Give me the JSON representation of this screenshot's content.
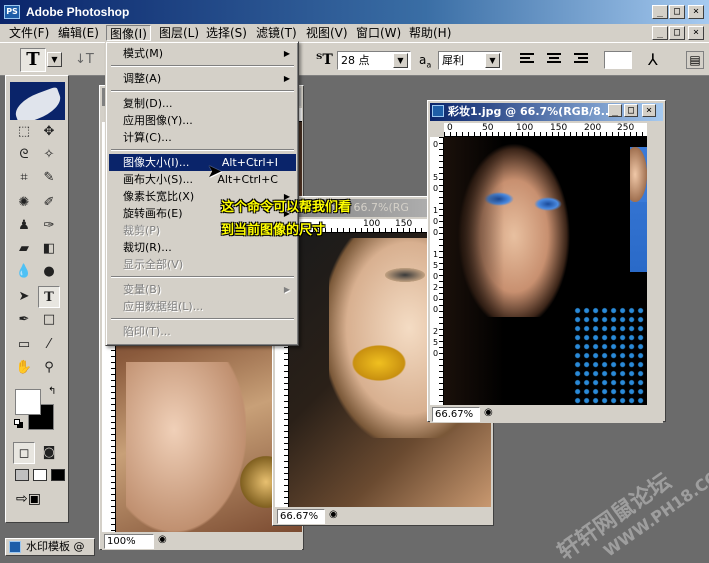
{
  "app": {
    "title": "Adobe Photoshop",
    "logo": "PS"
  },
  "caption_buttons": {
    "minimize": "_",
    "maximize": "□",
    "close": "×"
  },
  "menubar": [
    "文件(F)",
    "编辑(E)",
    "图像(I)",
    "图层(L)",
    "选择(S)",
    "滤镜(T)",
    "视图(V)",
    "窗口(W)",
    "帮助(H)"
  ],
  "options": {
    "tool_glyph": "T",
    "font_size": "28 点",
    "aa_label": "a",
    "aa_sub": "a",
    "aa_mode": "犀利"
  },
  "image_menu": {
    "items": [
      {
        "label": "模式(M)",
        "submenu": true
      },
      {
        "sep": true
      },
      {
        "label": "调整(A)",
        "submenu": true
      },
      {
        "sep": true
      },
      {
        "label": "复制(D)..."
      },
      {
        "label": "应用图像(Y)..."
      },
      {
        "label": "计算(C)..."
      },
      {
        "sep": true
      },
      {
        "label": "图像大小(I)...",
        "shortcut": "Alt+Ctrl+I",
        "highlighted": true
      },
      {
        "label": "画布大小(S)...",
        "shortcut": "Alt+Ctrl+C"
      },
      {
        "label": "像素长宽比(X)",
        "submenu": true
      },
      {
        "label": "旋转画布(E)",
        "submenu": true
      },
      {
        "label": "裁剪(P)",
        "disabled": true
      },
      {
        "label": "裁切(R)..."
      },
      {
        "label": "显示全部(V)",
        "disabled": true
      },
      {
        "sep": true
      },
      {
        "label": "变量(B)",
        "submenu": true,
        "disabled": true
      },
      {
        "label": "应用数据组(L)...",
        "disabled": true
      },
      {
        "sep": true
      },
      {
        "label": "陷印(T)...",
        "disabled": true
      }
    ]
  },
  "callout": {
    "line1": "这个命令可以帮我们看",
    "line2": "到当前图像的尺寸"
  },
  "windows": {
    "back": {
      "zoom": "100%"
    },
    "middle": {
      "title": "彩妆.jpg @ 66.7%(RG",
      "zoom": "66.67%",
      "ruler_ticks": [
        "100",
        "150"
      ]
    },
    "front": {
      "title": "彩妆1.jpg @ 66.7%(RGB/8...",
      "zoom": "66.67%",
      "ruler_ticks": [
        "0",
        "50",
        "100",
        "150",
        "200",
        "250"
      ],
      "vruler_ticks": [
        "0",
        "5",
        "0",
        "1",
        "0",
        "0",
        "1",
        "5",
        "0",
        "2",
        "0",
        "0",
        "2",
        "5",
        "0",
        "3",
        "0",
        "0",
        "3",
        "5",
        "0",
        "4",
        "0",
        "0"
      ]
    }
  },
  "taskbar": {
    "label": "水印模板 @ ..."
  },
  "watermark": {
    "line1": "轩轩网鼠论坛",
    "line2": "WWW.PH18.COM"
  }
}
